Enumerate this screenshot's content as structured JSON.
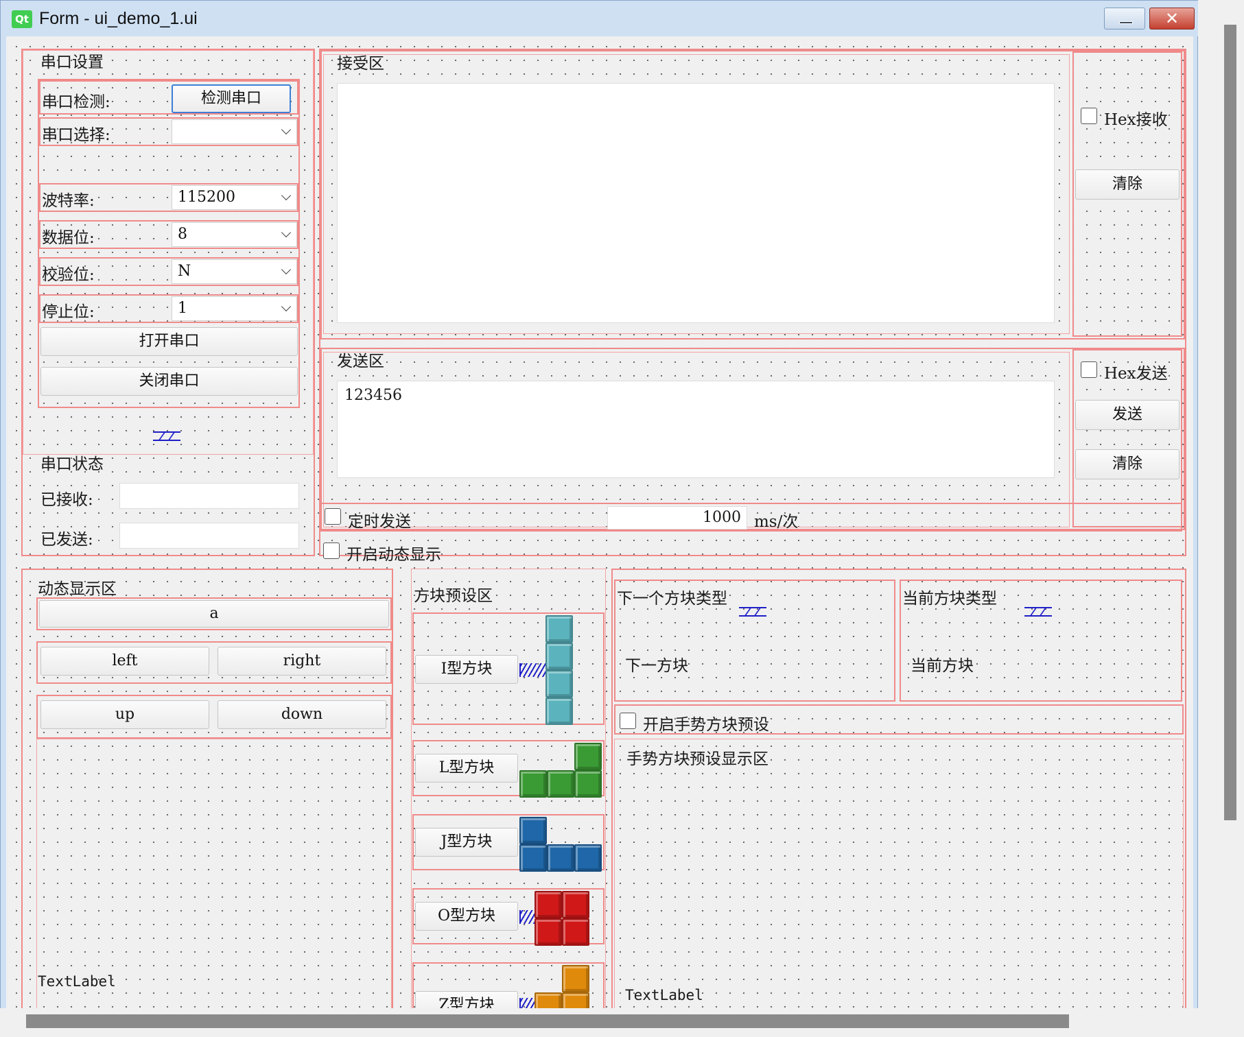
{
  "window": {
    "title": "Form - ui_demo_1.ui",
    "app_logo": "Qt",
    "close_glyph": "✕"
  },
  "serial": {
    "group_title": "串口设置",
    "detect_label": "串口检测:",
    "detect_button": "检测串口",
    "select_label": "串口选择:",
    "select_value": "",
    "baud_label": "波特率:",
    "baud_value": "115200",
    "data_label": "数据位:",
    "data_value": "8",
    "parity_label": "校验位:",
    "parity_value": "N",
    "stop_label": "停止位:",
    "stop_value": "1",
    "open_button": "打开串口",
    "close_button": "关闭串口",
    "status_title": "串口状态",
    "received_label": "已接收:",
    "received_value": "",
    "sent_label": "已发送:",
    "sent_value": ""
  },
  "receive": {
    "title": "接受区",
    "hex_label": "Hex接收",
    "hex_checked": false,
    "clear_button": "清除"
  },
  "send": {
    "title": "发送区",
    "text": "123456",
    "hex_label": "Hex发送",
    "hex_checked": false,
    "send_button": "发送",
    "clear_button": "清除"
  },
  "timer": {
    "label": "定时发送",
    "checked": false,
    "interval": "1000",
    "unit": "ms/次"
  },
  "dynamic_toggle": {
    "label": "开启动态显示",
    "checked": false
  },
  "dynamic": {
    "title": "动态显示区",
    "btn_a": "a",
    "btn_left": "left",
    "btn_right": "right",
    "btn_up": "up",
    "btn_down": "down",
    "text_label": "TextLabel"
  },
  "presets": {
    "title": "方块预设区",
    "items": [
      {
        "label": "I型方块",
        "color": "#5ab3bd"
      },
      {
        "label": "L型方块",
        "color": "#3a9a34"
      },
      {
        "label": "J型方块",
        "color": "#1f67a8"
      },
      {
        "label": "O型方块",
        "color": "#d01818"
      },
      {
        "label": "Z型方块",
        "color": "#e08a0c"
      }
    ]
  },
  "next_block": {
    "title": "下一个方块类型",
    "value": "下一方块"
  },
  "current_block": {
    "title": "当前方块类型",
    "value": "当前方块"
  },
  "gesture": {
    "label": "开启手势方块预设",
    "checked": false,
    "display_title": "手势方块预设显示区",
    "text_label": "TextLabel"
  }
}
